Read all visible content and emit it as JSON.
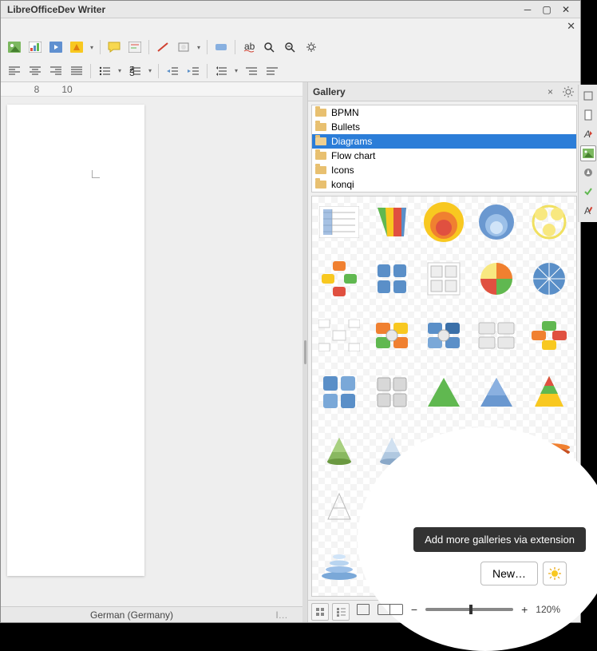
{
  "window": {
    "title": "LibreOfficeDev Writer"
  },
  "ruler": {
    "marks": [
      "8",
      "10"
    ]
  },
  "gallery": {
    "title": "Gallery",
    "categories": [
      "BPMN",
      "Bullets",
      "Diagrams",
      "Flow chart",
      "Icons",
      "konqi"
    ],
    "selected_index": 2
  },
  "tooltip": "Add more galleries via extension",
  "new_button": "New…",
  "status": {
    "language": "German (Germany)"
  },
  "zoom": {
    "percent": "120%"
  },
  "colors": {
    "selection": "#2b7dd8",
    "orange": "#f08030",
    "yellow": "#f8c820",
    "red": "#e05040",
    "green": "#60b850",
    "blue": "#5a8fc8",
    "gray": "#c8c8c8"
  }
}
